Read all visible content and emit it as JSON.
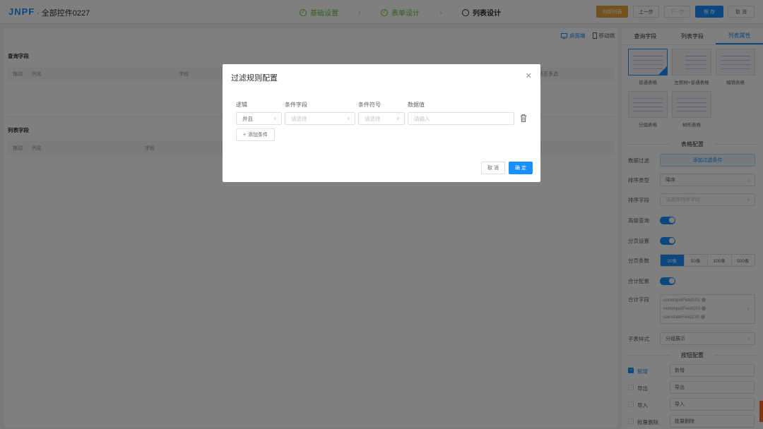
{
  "header": {
    "logo": "JNPF",
    "title": "· 全部控件0227",
    "steps": [
      {
        "label": "基础设置",
        "state": "done"
      },
      {
        "label": "表单设计",
        "state": "done"
      },
      {
        "label": "列表设计",
        "state": "active"
      }
    ],
    "buttons": {
      "yellow": "列印列表",
      "prev": "上一步",
      "next": "下一步",
      "save": "保 存",
      "cancel": "取 消"
    }
  },
  "main": {
    "devices": {
      "desktop": "桌面端",
      "mobile": "移动端"
    },
    "query_section": {
      "title": "查询字段",
      "headers": [
        "拖动",
        "列名",
        "字段",
        "是否多选"
      ]
    },
    "list_section": {
      "title": "列表字段",
      "headers": [
        "拖动",
        "列名",
        "字段"
      ]
    }
  },
  "right_panel": {
    "tabs": [
      "查询字段",
      "列表字段",
      "列表属性"
    ],
    "layouts": [
      "普通表格",
      "左侧树+普通表格",
      "编辑表格",
      "分组表格",
      "树形表格"
    ],
    "table_config": {
      "title": "表格配置",
      "data_filter": {
        "label": "数据过滤",
        "button": "添加过滤条件"
      },
      "sort_type": {
        "label": "排序类型",
        "value": "降序"
      },
      "sort_field": {
        "label": "排序字段",
        "placeholder": "请选择排序字段"
      },
      "advanced_query": {
        "label": "高级查询"
      },
      "pagination": {
        "label": "分页设置"
      },
      "page_size": {
        "label": "分页条数",
        "options": [
          "20条",
          "50条",
          "100条",
          "500条"
        ],
        "selected": "20条"
      },
      "summary_config": {
        "label": "合计配置"
      },
      "summary_fields": {
        "label": "合计字段",
        "tags": [
          "comInputField101",
          "numInputField103",
          "calculateField139"
        ]
      },
      "subtable_style": {
        "label": "子表样式",
        "value": "分组展示"
      }
    },
    "button_config": {
      "title": "按钮配置",
      "items": [
        {
          "label": "新增",
          "value": "新增",
          "checked": true
        },
        {
          "label": "导出",
          "value": "导出",
          "checked": false
        },
        {
          "label": "导入",
          "value": "导入",
          "checked": false
        },
        {
          "label": "批量删除",
          "value": "批量删除",
          "checked": false
        }
      ]
    }
  },
  "dialog": {
    "title": "过滤规则配置",
    "columns": {
      "logic": "逻辑",
      "field": "条件字段",
      "operator": "条件符号",
      "value": "数据值"
    },
    "row": {
      "logic": "并且",
      "field_placeholder": "请选择",
      "operator_placeholder": "请选择",
      "value_placeholder": "请输入"
    },
    "add_condition": "添加条件",
    "cancel": "取 消",
    "confirm": "确 定"
  }
}
